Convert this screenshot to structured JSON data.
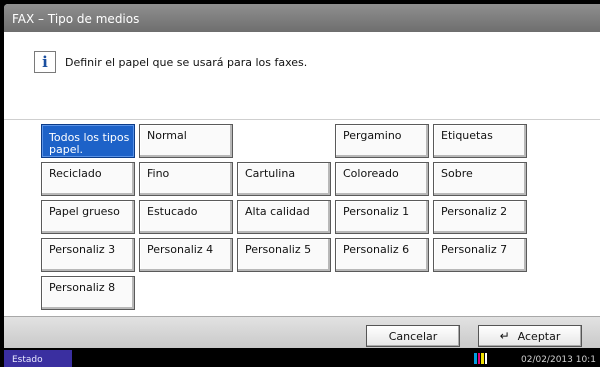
{
  "header": {
    "title": "FAX – Tipo de medios"
  },
  "info": {
    "icon": "info-icon",
    "glyph": "i",
    "message": "Definir el papel que se usará para los faxes."
  },
  "media_buttons": [
    {
      "label": "Todos los tipos papel.",
      "selected": true
    },
    {
      "label": "Normal"
    },
    {
      "label": "Pergamino"
    },
    {
      "label": "Etiquetas"
    },
    {
      "label": "Reciclado"
    },
    {
      "label": "Fino"
    },
    {
      "label": "Cartulina"
    },
    {
      "label": "Coloreado"
    },
    {
      "label": "Sobre"
    },
    {
      "label": "Papel grueso"
    },
    {
      "label": "Estucado"
    },
    {
      "label": "Alta calidad"
    },
    {
      "label": "Personaliz 1"
    },
    {
      "label": "Personaliz 2"
    },
    {
      "label": "Personaliz 3"
    },
    {
      "label": "Personaliz 4"
    },
    {
      "label": "Personaliz 5"
    },
    {
      "label": "Personaliz 6"
    },
    {
      "label": "Personaliz 7"
    },
    {
      "label": "Personaliz 8"
    }
  ],
  "footer": {
    "cancel_label": "Cancelar",
    "accept_label": "Aceptar",
    "accept_icon": "enter-arrow-icon"
  },
  "status": {
    "estado_label": "Estado",
    "datetime": "02/02/2013  10:1",
    "toner_icon": "toner-level-icon"
  },
  "colors": {
    "selected": "#1d62c8",
    "title_bar": "#7a7a7a",
    "status_button": "#3a2fa0"
  }
}
